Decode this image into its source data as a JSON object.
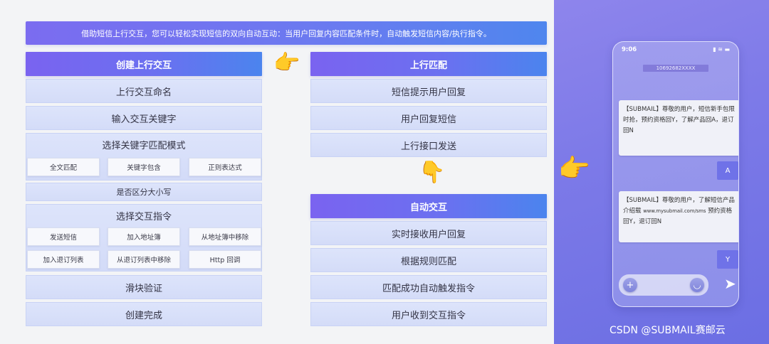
{
  "banner": "借助短信上行交互，您可以轻松实现短信的双向自动互动：当用户回复内容匹配条件时，自动触发短信内容/执行指令。",
  "left": {
    "header": "创建上行交互",
    "rows": [
      "上行交互命名",
      "输入交互关键字"
    ],
    "match_panel": {
      "title": "选择关键字匹配模式",
      "chips": [
        "全文匹配",
        "关键字包含",
        "正则表达式"
      ]
    },
    "case_row": "是否区分大小写",
    "cmd_panel": {
      "title": "选择交互指令",
      "chips": [
        "发送短信",
        "加入地址簿",
        "从地址簿中移除",
        "加入退订列表",
        "从退订列表中移除",
        "Http 回调"
      ]
    },
    "bottom_rows": [
      "滑块验证",
      "创建完成"
    ]
  },
  "middle": {
    "match_header": "上行匹配",
    "match_rows": [
      "短信提示用户回复",
      "用户回复短信",
      "上行接口发送"
    ],
    "auto_header": "自动交互",
    "auto_rows": [
      "实时接收用户回复",
      "根据规则匹配",
      "匹配成功自动触发指令",
      "用户收到交互指令"
    ]
  },
  "phone": {
    "time": "9:06",
    "status": "▮ ≋ ▬",
    "number": "10692682XXXX",
    "msg1": "【SUBMAIL】尊敬的用户，短信新手包限时抢，预约资格回Y，了解产品回A，退订回N",
    "reply1": "A",
    "msg2_part1": "【SUBMAIL】尊敬的用户，了解短信产品介绍载 ",
    "msg2_url": "www.mysubmail.com/sms",
    "msg2_part2": " 预约资格回Y，退订回N",
    "reply2": "Y",
    "plus": "+",
    "mic": "◡",
    "send": "➤"
  },
  "icons": {
    "hand_right": "👉",
    "hand_down": "👇"
  },
  "watermark": "CSDN @SUBMAIL赛邮云"
}
